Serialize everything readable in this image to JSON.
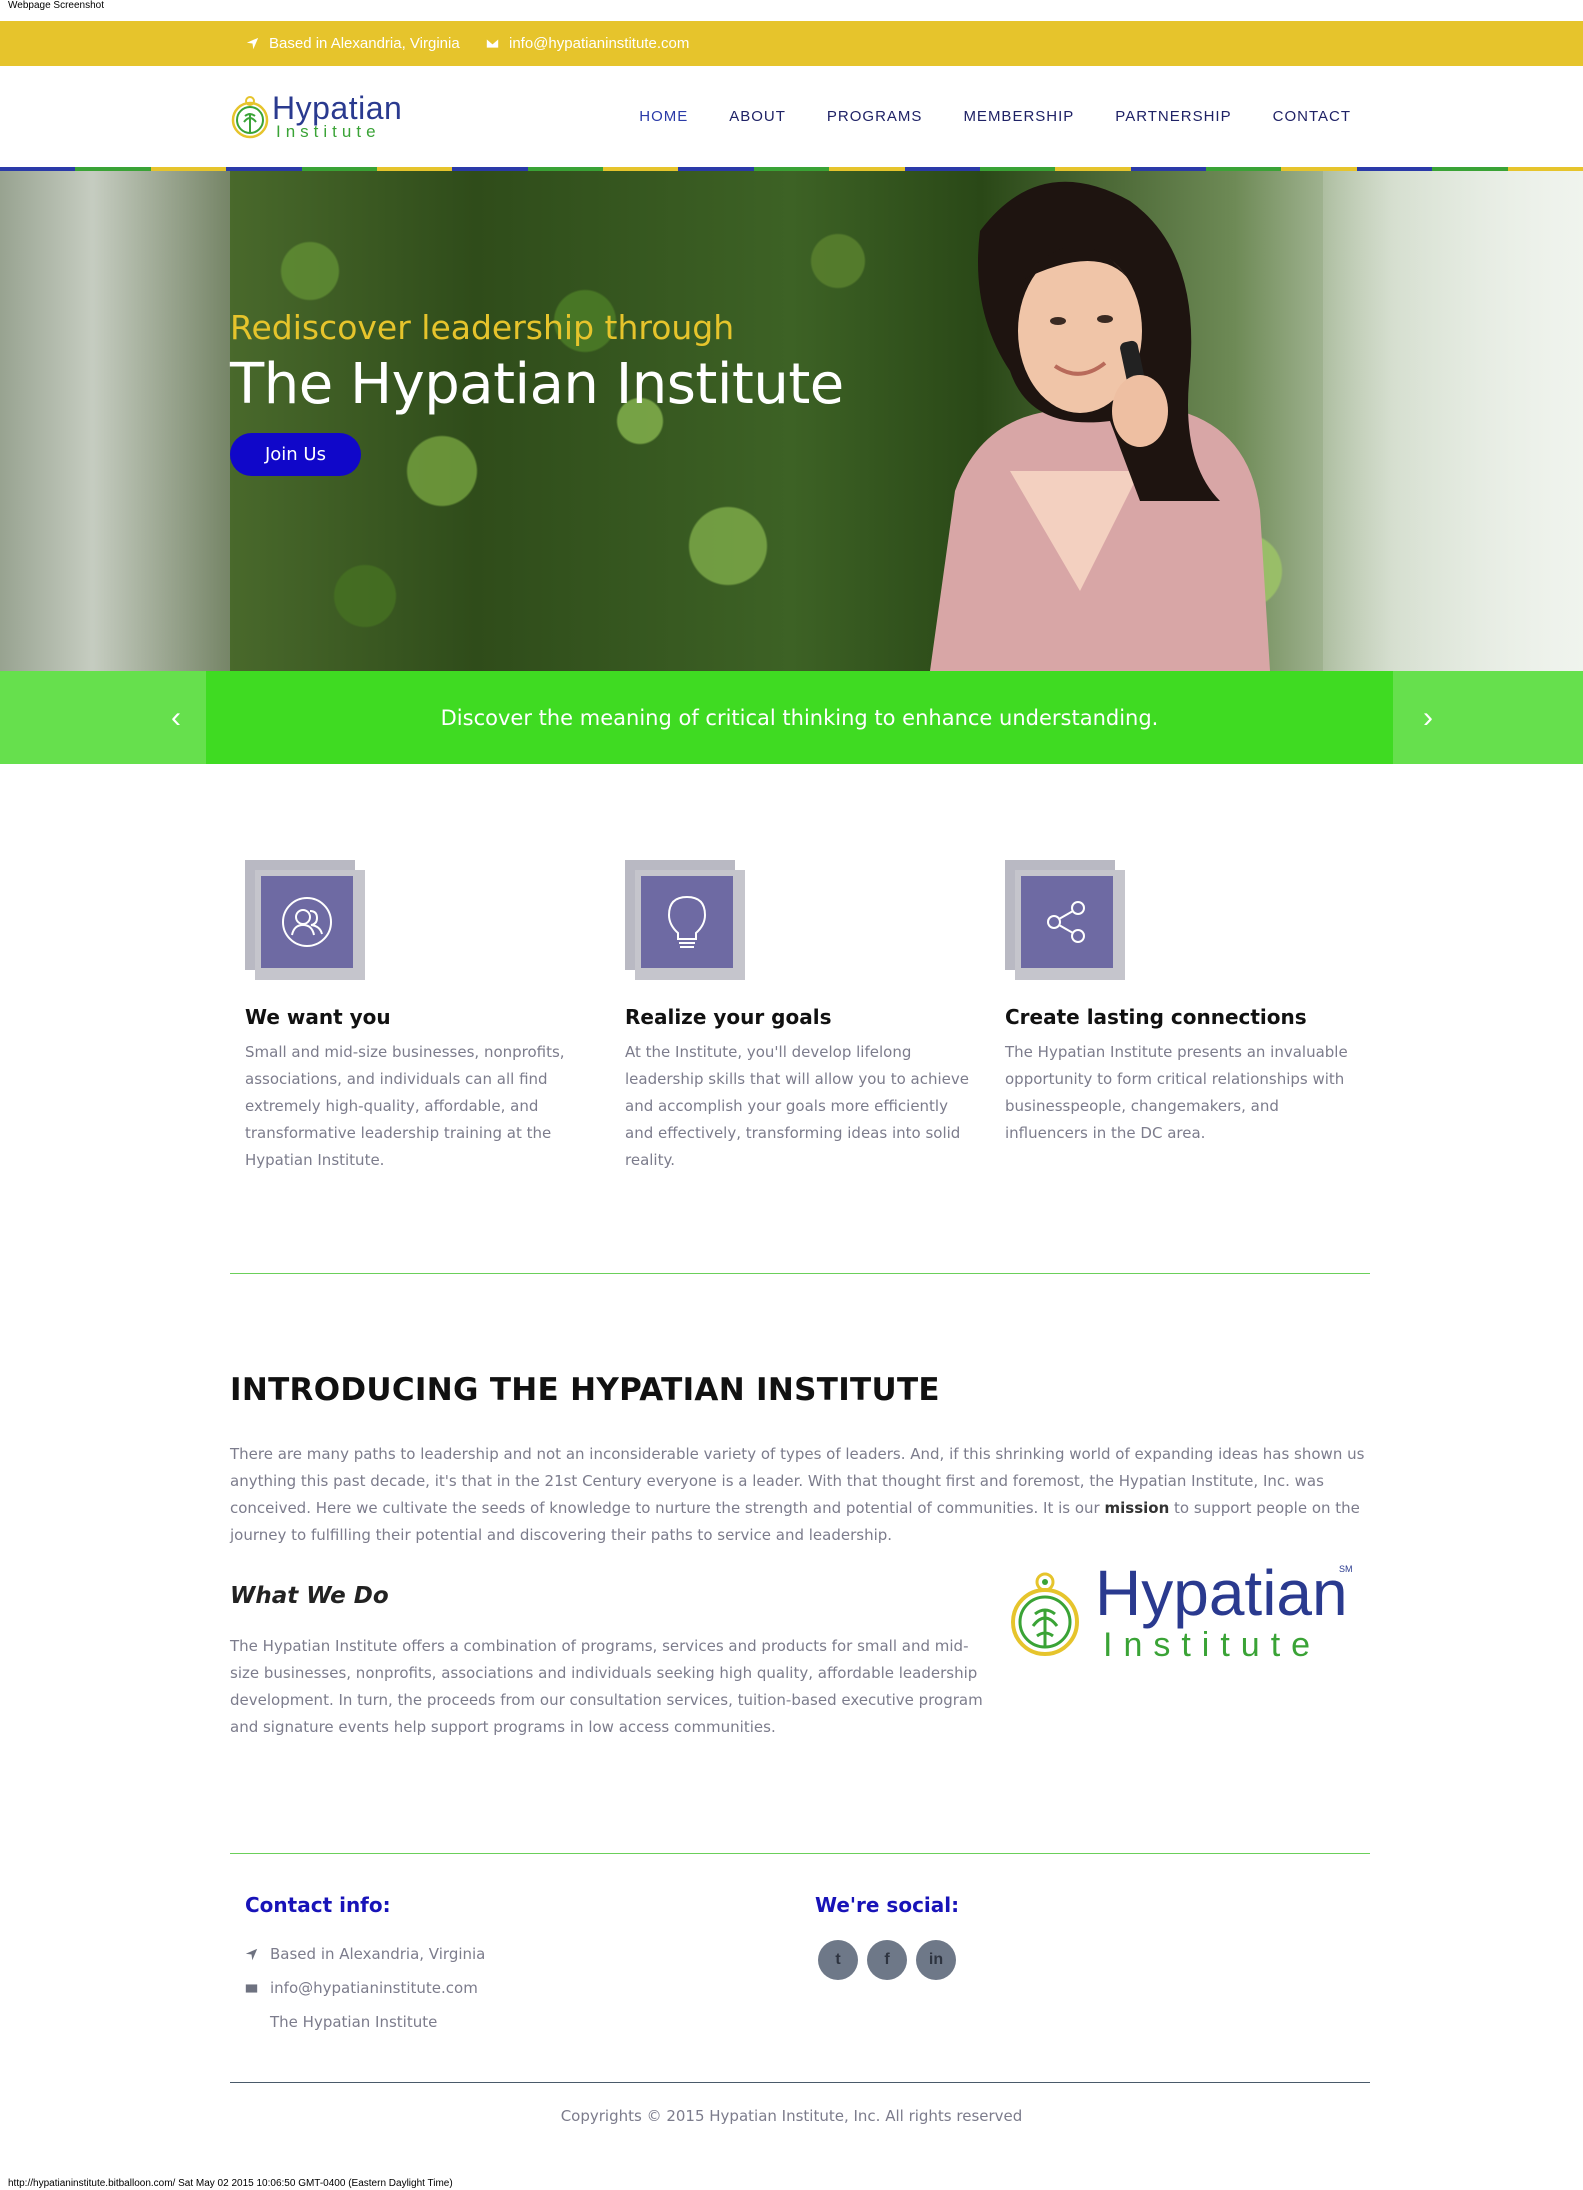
{
  "capture": {
    "label": "Webpage Screenshot",
    "footer": "http://hypatianinstitute.bitballoon.com/ Sat May 02 2015 10:06:50 GMT-0400 (Eastern Daylight Time)"
  },
  "topbar": {
    "location": "Based in Alexandria, Virginia",
    "email": "info@hypatianinstitute.com",
    "location_icon": "location-arrow-icon",
    "email_icon": "envelope-icon",
    "color": "#e6c42c"
  },
  "logo": {
    "word1": "Hypatian",
    "word2": "Institute",
    "sm": "SM"
  },
  "nav": {
    "items": [
      {
        "label": "HOME"
      },
      {
        "label": "ABOUT"
      },
      {
        "label": "PROGRAMS"
      },
      {
        "label": "MEMBERSHIP"
      },
      {
        "label": "PARTNERSHIP"
      },
      {
        "label": "CONTACT"
      }
    ],
    "active": "HOME"
  },
  "stripe_colors": [
    "#2a3aa8",
    "#3aa336",
    "#e6c42c"
  ],
  "hero": {
    "subtitle": "Rediscover leadership through",
    "title": "The Hypatian Institute",
    "button": "Join Us"
  },
  "slider": {
    "text": "Discover the meaning of critical thinking to enhance understanding.",
    "prev_icon": "chevron-left-icon",
    "next_icon": "chevron-right-icon",
    "prev": "‹",
    "next": "›"
  },
  "features": [
    {
      "icon": "users-icon",
      "title": "We want you",
      "text": "Small and mid-size businesses, nonprofits, associations, and individuals can all find extremely high-quality, affordable, and transformative leadership training at the Hypatian Institute."
    },
    {
      "icon": "lightbulb-icon",
      "title": "Realize your goals",
      "text": "At the Institute, you'll develop lifelong leadership skills that will allow you to achieve and accomplish your goals more efficiently and effectively, transforming ideas into solid reality."
    },
    {
      "icon": "share-icon",
      "title": "Create lasting connections",
      "text": "The Hypatian Institute presents an invaluable opportunity to form critical relationships with businesspeople, changemakers, and influencers in the DC area."
    }
  ],
  "intro": {
    "title": "INTRODUCING THE HYPATIAN INSTITUTE",
    "text_before": "There are many paths to leadership and not an inconsiderable variety of types of leaders. And, if this shrinking world of expanding ideas has shown us anything this past decade, it's that in the 21st Century everyone is a leader. With that thought first and foremost, the Hypatian Institute, Inc. was conceived. Here we cultivate the seeds of knowledge to nurture the strength and potential of communities. It is our ",
    "text_bold": "mission",
    "text_after": " to support people on the journey to fulfilling their potential and discovering their paths to service and leadership.",
    "what_title": "What We Do",
    "what_text": "The Hypatian Institute offers a combination of programs, services and products for small and mid-size businesses, nonprofits, associations and individuals seeking high quality, affordable leadership development. In turn, the proceeds from our consultation services, tuition-based executive program and signature events help support programs in low access communities."
  },
  "contact": {
    "title": "Contact info:",
    "location": "Based in Alexandria, Virginia",
    "email": "info@hypatianinstitute.com",
    "name": "The Hypatian Institute"
  },
  "social": {
    "title": "We're social:",
    "items": [
      {
        "icon": "twitter-icon",
        "glyph": "t"
      },
      {
        "icon": "facebook-icon",
        "glyph": "f"
      },
      {
        "icon": "linkedin-icon",
        "glyph": "in"
      }
    ]
  },
  "footer": {
    "copyright": "Copyrights © 2015 Hypatian Institute, Inc. All rights reserved"
  }
}
